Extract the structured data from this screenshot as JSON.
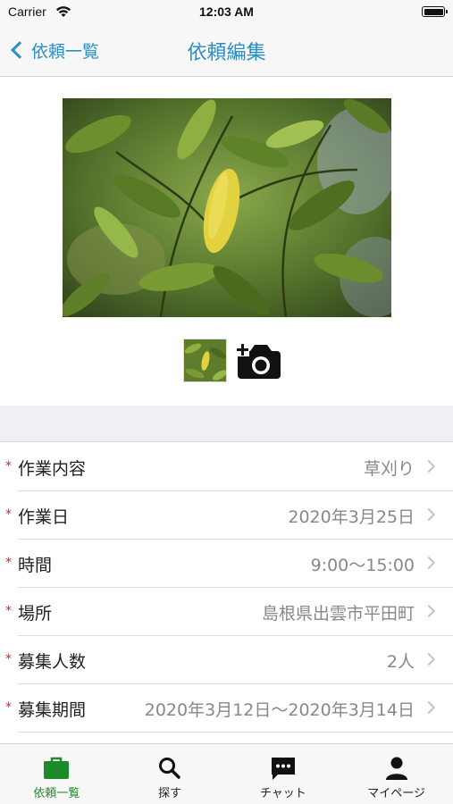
{
  "status_bar": {
    "carrier": "Carrier",
    "time": "12:03 AM"
  },
  "nav": {
    "back_label": "依頼一覧",
    "title": "依頼編集",
    "accent_color": "#2a8fc4"
  },
  "photos": {
    "main": "leaf-photo",
    "thumbnails": [
      "leaf-photo"
    ],
    "add_icon": "add-camera-icon"
  },
  "form": {
    "rows": [
      {
        "required": "*",
        "label": "作業内容",
        "value": "草刈り"
      },
      {
        "required": "*",
        "label": "作業日",
        "value": "2020年3月25日"
      },
      {
        "required": "*",
        "label": "時間",
        "value": "9:00～15:00"
      },
      {
        "required": "*",
        "label": "場所",
        "value": "島根県出雲市平田町"
      },
      {
        "required": "*",
        "label": "募集人数",
        "value": "2人"
      },
      {
        "required": "*",
        "label": "募集期間",
        "value": "2020年3月12日～2020年3月14日"
      }
    ]
  },
  "tab_bar": {
    "active_color": "#1e8a2a",
    "tabs": [
      {
        "label": "依頼一覧",
        "icon": "briefcase-icon",
        "active": true
      },
      {
        "label": "探す",
        "icon": "search-icon",
        "active": false
      },
      {
        "label": "チャット",
        "icon": "chat-icon",
        "active": false
      },
      {
        "label": "マイページ",
        "icon": "person-icon",
        "active": false
      }
    ]
  }
}
